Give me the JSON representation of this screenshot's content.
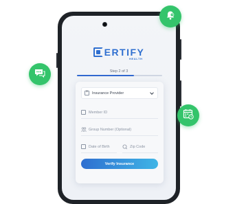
{
  "brand": {
    "name": "ERTIFY",
    "sub": "HEALTH"
  },
  "progress": {
    "step_text": "Step 2 of 3",
    "fraction": 0.67
  },
  "form": {
    "insurance_provider": "Insurance Provider",
    "member_id_placeholder": "Member ID",
    "group_number_placeholder": "Group Number (Optional)",
    "dob_placeholder": "Date of Birth",
    "zip_placeholder": "Zip Code",
    "submit_label": "Verify Insurance"
  },
  "colors": {
    "accent": "#2f6fd0",
    "accent_light": "#3fb5e6",
    "badge": "#34c46b",
    "phone": "#1e2227"
  },
  "icons": [
    "bell-icon",
    "chat-icon",
    "calendar-icon",
    "plus-box-icon",
    "id-card-icon",
    "group-icon",
    "calendar-small-icon",
    "location-pin-icon",
    "chevron-down-icon"
  ]
}
